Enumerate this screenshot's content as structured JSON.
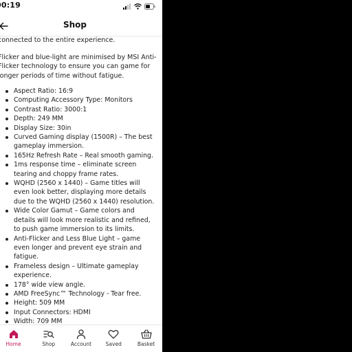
{
  "status_bar": {
    "time": "00:19"
  },
  "header": {
    "title": "Shop",
    "back_icon": "arrow-left-icon"
  },
  "content": {
    "paragraphs": [
      "connected to the entire experience.",
      "Flicker and blue-light are minimised by MSI Anti-Flicker technology to ensure you can game for longer periods of time without fatigue."
    ],
    "specs": [
      "Aspect Ratio: 16:9",
      "Computing Accessory Type: Monitors",
      "Contrast Ratio: 3000:1",
      "Depth: 249 MM",
      "Display Size: 30in",
      "Curved Gaming display (1500R) – The best gameplay immersion.",
      "165Hz Refresh Rate – Real smooth gaming.",
      "1ms response time – eliminate screen tearing and choppy frame rates.",
      "WQHD (2560 x 1440) – Game titles will even look better, displaying more details due to the WQHD (2560 x 1440) resolution.",
      "Wide Color Gamut – Game colors and details will look more realistic and refined, to push game immersion to its limits.",
      "Anti-Flicker and Less Blue Light – game even longer and prevent eye strain and fatigue.",
      "Frameless design – Ultimate gameplay experience.",
      "178° wide view angle.",
      "AMD FreeSync™ Technology - Tear free.",
      "Height: 509 MM",
      "Input Connectors: HDMI",
      "Width: 709 MM"
    ]
  },
  "tab_bar": {
    "tabs": [
      {
        "label": "Home",
        "icon": "home-icon",
        "active": true
      },
      {
        "label": "Shop",
        "icon": "shop-search-icon",
        "active": false
      },
      {
        "label": "Account",
        "icon": "person-icon",
        "active": false
      },
      {
        "label": "Saved",
        "icon": "heart-icon",
        "active": false
      },
      {
        "label": "Basket",
        "icon": "basket-icon",
        "active": false
      }
    ]
  },
  "colors": {
    "accent": "#c2185b",
    "text": "#222222",
    "background": "#ffffff",
    "outside": "#000000"
  }
}
